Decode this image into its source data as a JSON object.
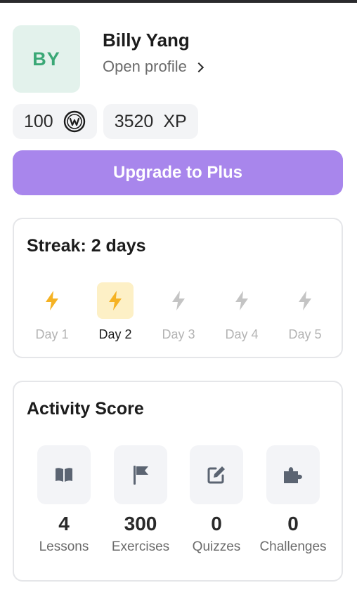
{
  "user": {
    "initials": "BY",
    "name": "Billy Yang",
    "open_profile_label": "Open profile"
  },
  "stats": {
    "coins": "100",
    "xp_value": "3520",
    "xp_unit": "XP"
  },
  "upgrade_label": "Upgrade to Plus",
  "streak": {
    "title": "Streak: 2 days",
    "days": [
      {
        "label": "Day 1",
        "state": "completed"
      },
      {
        "label": "Day 2",
        "state": "current"
      },
      {
        "label": "Day 3",
        "state": "upcoming"
      },
      {
        "label": "Day 4",
        "state": "upcoming"
      },
      {
        "label": "Day 5",
        "state": "upcoming"
      }
    ]
  },
  "activity": {
    "title": "Activity Score",
    "items": [
      {
        "icon": "book-icon",
        "value": "4",
        "label": "Lessons"
      },
      {
        "icon": "flag-icon",
        "value": "300",
        "label": "Exercises"
      },
      {
        "icon": "edit-icon",
        "value": "0",
        "label": "Quizzes"
      },
      {
        "icon": "puzzle-icon",
        "value": "0",
        "label": "Challenges"
      }
    ]
  },
  "colors": {
    "accent": "#a886ec",
    "avatar_text": "#3aa876",
    "bolt_active": "#f5b223",
    "bolt_inactive": "#c4c4c4"
  }
}
